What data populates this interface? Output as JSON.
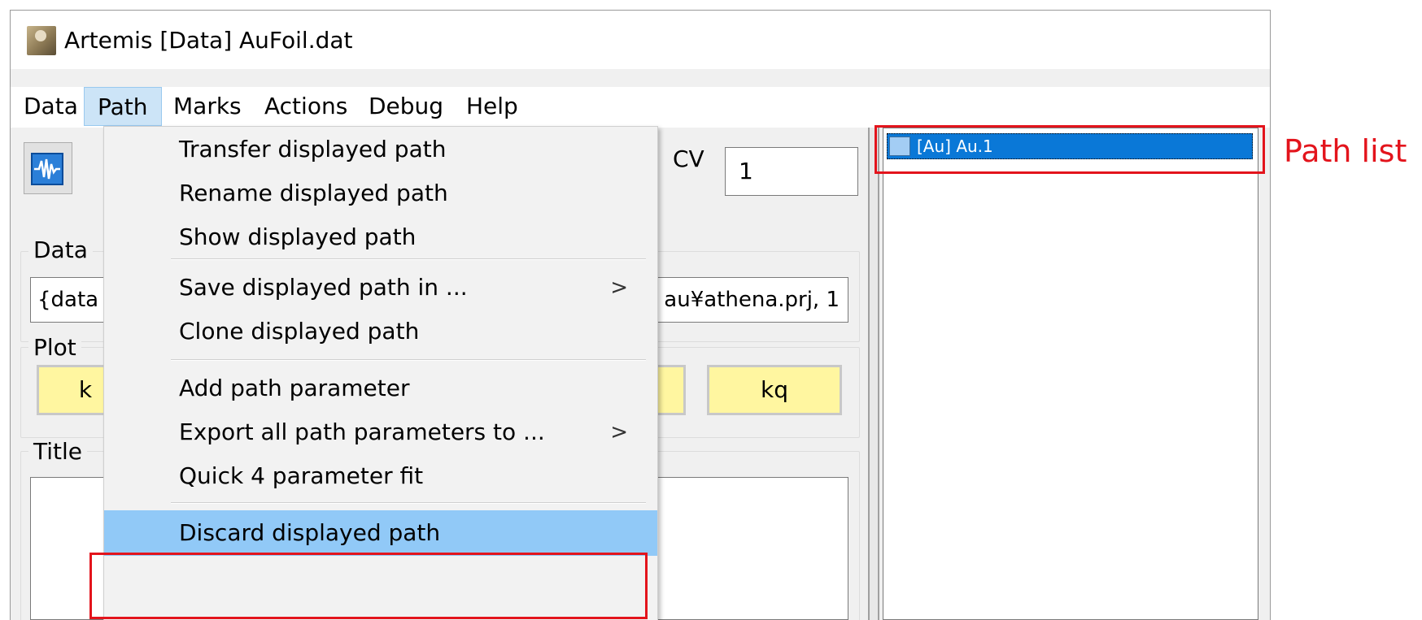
{
  "window": {
    "title": "Artemis [Data] AuFoil.dat",
    "icon": "artemis-app-icon"
  },
  "menubar": {
    "items": [
      "Data",
      "Path",
      "Marks",
      "Actions",
      "Debug",
      "Help"
    ],
    "active": "Path"
  },
  "toolbar": {
    "plot_icon": "waveform-icon",
    "cv_label": "CV",
    "cv_value": "1"
  },
  "groups": {
    "data_label": "Data",
    "plot_label": "Plot",
    "title_label": "Title"
  },
  "data_source": {
    "left_text": "{data",
    "right_text": "au¥athena.prj, 1"
  },
  "plot_buttons": {
    "left": "k",
    "right": "kq"
  },
  "path_menu": {
    "items": [
      {
        "label": "Transfer displayed path",
        "submenu": false
      },
      {
        "label": "Rename displayed path",
        "submenu": false
      },
      {
        "label": "Show displayed path",
        "submenu": false
      },
      {
        "label": "Save displayed path in ...",
        "submenu": true
      },
      {
        "label": "Clone displayed path",
        "submenu": false
      },
      {
        "label": "Add path parameter",
        "submenu": false
      },
      {
        "label": "Export all path parameters to ...",
        "submenu": true
      },
      {
        "label": "Quick 4 parameter fit",
        "submenu": false
      },
      {
        "label": "Discard displayed path",
        "submenu": false,
        "highlighted": true
      }
    ],
    "submenu_arrow": ">"
  },
  "path_list": {
    "items": [
      {
        "label": "[Au] Au.1",
        "selected": true
      }
    ]
  },
  "annotation": {
    "label": "Path list",
    "color": "#e3141c"
  }
}
